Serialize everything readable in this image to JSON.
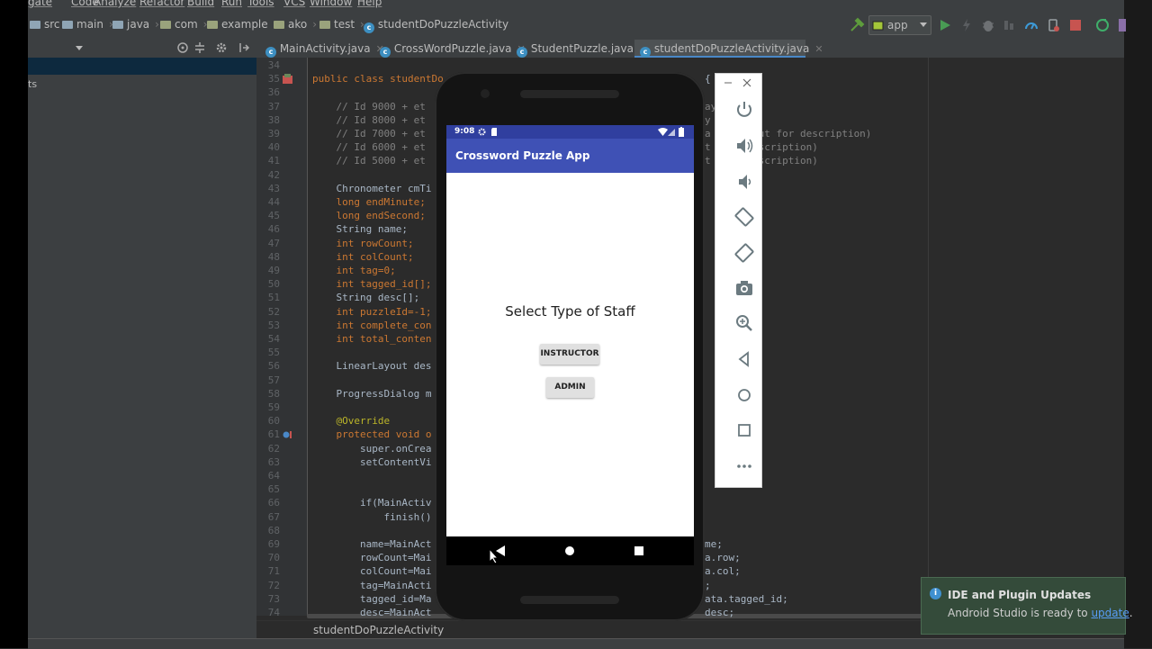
{
  "menu": {
    "items": [
      "gate",
      "Code",
      "Analyze",
      "Refactor",
      "Build",
      "Run",
      "Tools",
      "VCS",
      "Window",
      "Help"
    ]
  },
  "breadcrumb": {
    "items": [
      "src",
      "main",
      "java",
      "com",
      "example",
      "ako",
      "test",
      "studentDoPuzzleActivity"
    ]
  },
  "toolbar": {
    "run_config": "app"
  },
  "project_panel": {
    "partial_text": "ts"
  },
  "tabs": [
    {
      "label": "MainActivity.java",
      "active": false
    },
    {
      "label": "CrossWordPuzzle.java",
      "active": false
    },
    {
      "label": "StudentPuzzle.java",
      "active": false
    },
    {
      "label": "studentDoPuzzleActivity.java",
      "active": true
    }
  ],
  "editor": {
    "lines": [
      {
        "n": "34",
        "code": ""
      },
      {
        "n": "35",
        "code": "public class studentDo"
      },
      {
        "n": "36",
        "code": ""
      },
      {
        "n": "37",
        "code": "    // Id 9000 + et"
      },
      {
        "n": "38",
        "code": "    // Id 8000 + et"
      },
      {
        "n": "39",
        "code": "    // Id 7000 + et"
      },
      {
        "n": "40",
        "code": "    // Id 6000 + et"
      },
      {
        "n": "41",
        "code": "    // Id 5000 + et"
      },
      {
        "n": "42",
        "code": ""
      },
      {
        "n": "43",
        "code": "    Chronometer cmTi"
      },
      {
        "n": "44",
        "code": "    long endMinute;"
      },
      {
        "n": "45",
        "code": "    long endSecond;"
      },
      {
        "n": "46",
        "code": "    String name;"
      },
      {
        "n": "47",
        "code": "    int rowCount;"
      },
      {
        "n": "48",
        "code": "    int colCount;"
      },
      {
        "n": "49",
        "code": "    int tag=0;"
      },
      {
        "n": "50",
        "code": "    int tagged_id[];"
      },
      {
        "n": "51",
        "code": "    String desc[];"
      },
      {
        "n": "52",
        "code": "    int puzzleId=-1;"
      },
      {
        "n": "53",
        "code": "    int complete_con"
      },
      {
        "n": "54",
        "code": "    int total_conten"
      },
      {
        "n": "55",
        "code": ""
      },
      {
        "n": "56",
        "code": "    LinearLayout des"
      },
      {
        "n": "57",
        "code": ""
      },
      {
        "n": "58",
        "code": "    ProgressDialog m"
      },
      {
        "n": "59",
        "code": ""
      },
      {
        "n": "60",
        "code": "    @Override"
      },
      {
        "n": "61",
        "code": "    protected void o"
      },
      {
        "n": "62",
        "code": "        super.onCrea"
      },
      {
        "n": "63",
        "code": "        setContentVi"
      },
      {
        "n": "64",
        "code": ""
      },
      {
        "n": "65",
        "code": ""
      },
      {
        "n": "66",
        "code": "        if(MainActiv"
      },
      {
        "n": "67",
        "code": "            finish()"
      },
      {
        "n": "68",
        "code": ""
      },
      {
        "n": "69",
        "code": "        name=MainAct"
      },
      {
        "n": "70",
        "code": "        rowCount=Mai"
      },
      {
        "n": "71",
        "code": "        colCount=Mai"
      },
      {
        "n": "72",
        "code": "        tag=MainActi"
      },
      {
        "n": "73",
        "code": "        tagged_id=Ma"
      },
      {
        "n": "74",
        "code": "        desc=MainAct"
      }
    ],
    "right_fragments": [
      {
        "line": "35",
        "text": "{"
      },
      {
        "line": "37",
        "text": "ay"
      },
      {
        "line": "38",
        "text": "y"
      },
      {
        "line": "39",
        "text": "a        ut for description)"
      },
      {
        "line": "40",
        "text": "t      description)"
      },
      {
        "line": "41",
        "text": "t      description)"
      },
      {
        "line": "69",
        "text": "me;"
      },
      {
        "line": "70",
        "text": "a.row;"
      },
      {
        "line": "71",
        "text": "a.col;"
      },
      {
        "line": "72",
        "text": ";"
      },
      {
        "line": "73",
        "text": "ata.tagged_id;"
      },
      {
        "line": "74",
        "text": "desc;"
      }
    ],
    "crumb": "studentDoPuzzleActivity"
  },
  "emulator": {
    "status_time": "9:08",
    "app_title": "Crossword Puzzle App",
    "prompt": "Select Type of Staff",
    "instructor_button": "INSTRUCTOR",
    "admin_button": "ADMIN",
    "panel_buttons": [
      "power-icon",
      "volume-up-icon",
      "volume-down-icon",
      "rotate-left-icon",
      "rotate-right-icon",
      "camera-icon",
      "zoom-icon",
      "back-icon",
      "home-icon",
      "overview-icon",
      "more-icon"
    ]
  },
  "notification": {
    "title": "IDE and Plugin Updates",
    "body": "Android Studio is ready to ",
    "link": "update",
    "tail": "."
  },
  "colors": {
    "app_bar": "#3f51b5",
    "status_bar": "#303f9f",
    "ide_bg": "#2b2b2b"
  }
}
